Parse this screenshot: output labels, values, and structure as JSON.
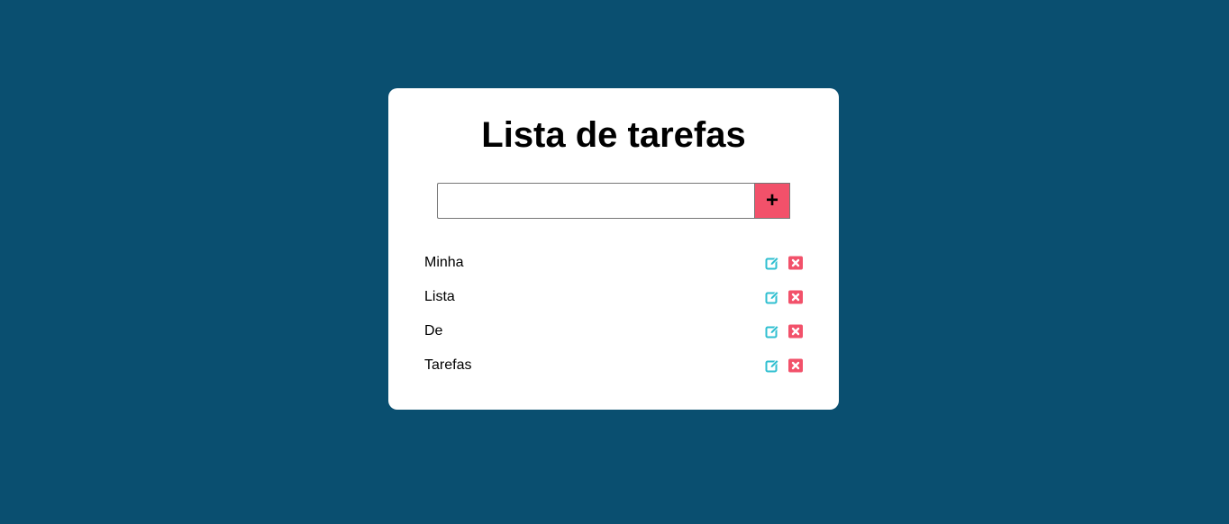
{
  "app": {
    "title": "Lista de tarefas"
  },
  "form": {
    "input_value": "",
    "input_placeholder": "",
    "add_label": "+"
  },
  "tasks": [
    {
      "text": "Minha"
    },
    {
      "text": "Lista"
    },
    {
      "text": "De"
    },
    {
      "text": "Tarefas"
    }
  ],
  "icons": {
    "edit": "edit-icon",
    "delete": "close-square-icon"
  },
  "colors": {
    "background": "#0a4f70",
    "card": "#ffffff",
    "accent": "#f2516a",
    "edit_icon": "#2fbfd0",
    "delete_icon": "#f2516a"
  }
}
